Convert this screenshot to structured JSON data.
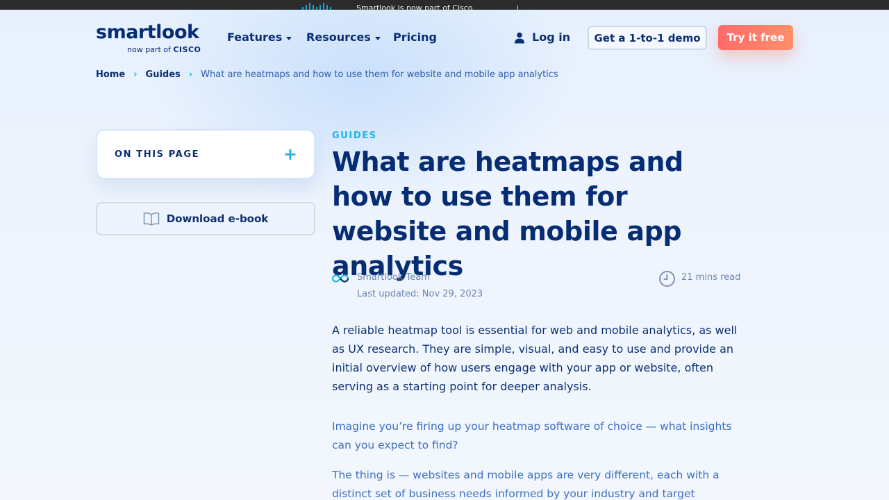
{
  "topbar": {
    "promo_text": "Smartlook is now part of Cisco",
    "accent": "#1ba0d7"
  },
  "header": {
    "logo_word": "smartlook",
    "logo_sub_prefix": "now part of",
    "logo_sub_brand": "CISCO",
    "nav": [
      {
        "label": "Features",
        "has_dropdown": true
      },
      {
        "label": "Resources",
        "has_dropdown": true
      },
      {
        "label": "Pricing",
        "has_dropdown": false
      }
    ],
    "login_label": "Log in",
    "demo_label": "Get a 1-to-1 demo",
    "try_label": "Try it free"
  },
  "breadcrumb": {
    "items": [
      "Home",
      "Guides"
    ],
    "current": "What are heatmaps and how to use them for website and mobile app analytics"
  },
  "sidebar": {
    "toc_label": "ON THIS PAGE",
    "ebook_label": "Download e-book"
  },
  "article": {
    "kicker": "GUIDES",
    "title": "What are heatmaps and how to use them for website and mobile app analytics",
    "author": "Smartlook Team",
    "updated": "Last updated: Nov 29, 2023",
    "read_time": "21 mins read",
    "lead": "A reliable heatmap tool is essential for web and mobile analytics, as well as UX research. They are simple, visual, and easy to use and provide an initial overview of how users engage with your app or website, often serving as a starting point for deeper analysis.",
    "paragraphs": [
      "Imagine you’re firing up your heatmap software of choice — what insights can you expect to find?",
      "The thing is — websites and mobile apps are very different, each with a distinct set of business needs informed by your industry and target"
    ]
  },
  "colors": {
    "navy": "#062d73",
    "cyan": "#1fb3e8",
    "cta_start": "#ff6b6b",
    "cta_end": "#ff8f6a"
  }
}
